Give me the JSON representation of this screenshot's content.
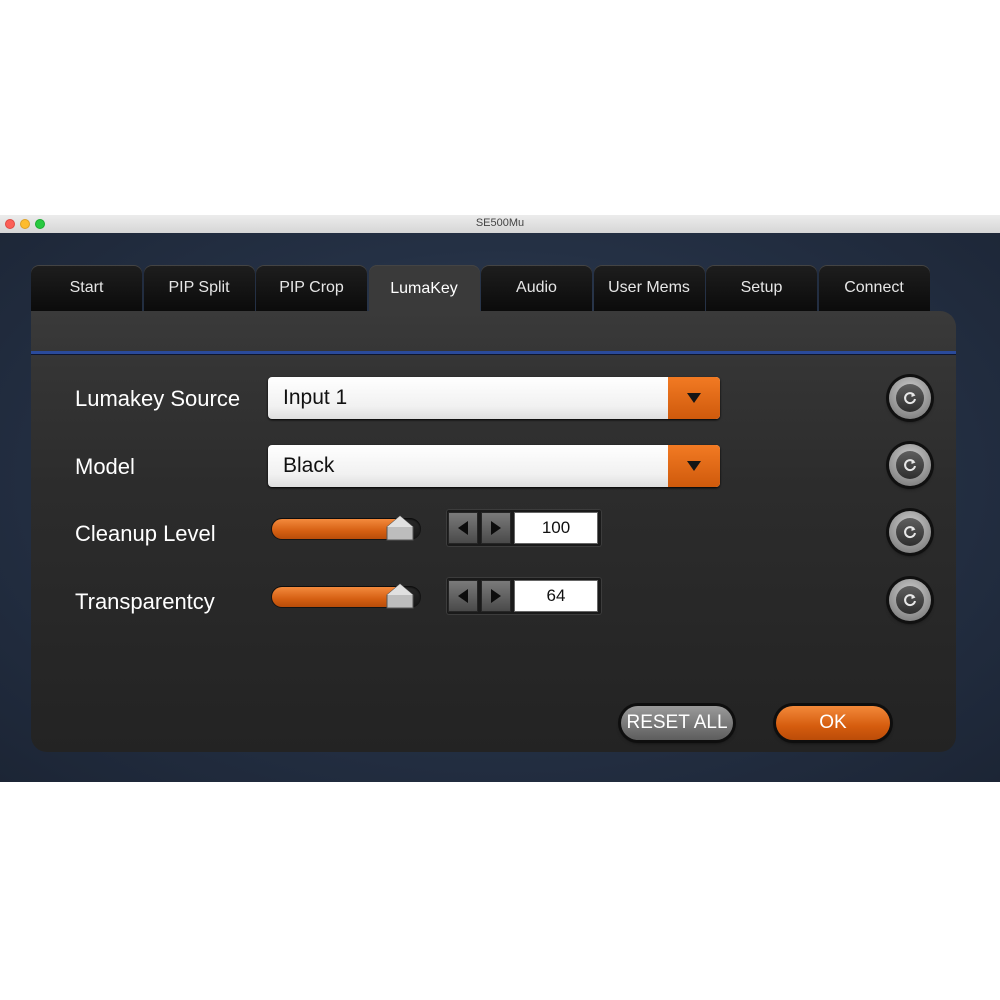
{
  "window": {
    "title": "SE500Mu"
  },
  "tabs": [
    {
      "label": "Start"
    },
    {
      "label": "PIP Split"
    },
    {
      "label": "PIP Crop"
    },
    {
      "label": "LumaKey",
      "active": true
    },
    {
      "label": "Audio"
    },
    {
      "label": "User Mems"
    },
    {
      "label": "Setup"
    },
    {
      "label": "Connect"
    }
  ],
  "fields": {
    "lumakey_source": {
      "label": "Lumakey Source",
      "value": "Input 1"
    },
    "model": {
      "label": "Model",
      "value": "Black"
    },
    "cleanup_level": {
      "label": "Cleanup Level",
      "value": "100",
      "fill_fraction": 0.85
    },
    "transparency": {
      "label": "Transparentcy",
      "value": "64",
      "fill_fraction": 0.85
    }
  },
  "buttons": {
    "reset_all": "RESET ALL",
    "ok": "OK"
  },
  "icons": {
    "dropdown": "triangle-down-icon",
    "step_left": "triangle-left-icon",
    "step_right": "triangle-right-icon",
    "reset": "circular-arrow-icon"
  },
  "colors": {
    "accent": "#e0661a",
    "panel": "#2c2c2c",
    "divider": "#2a4a9a"
  }
}
